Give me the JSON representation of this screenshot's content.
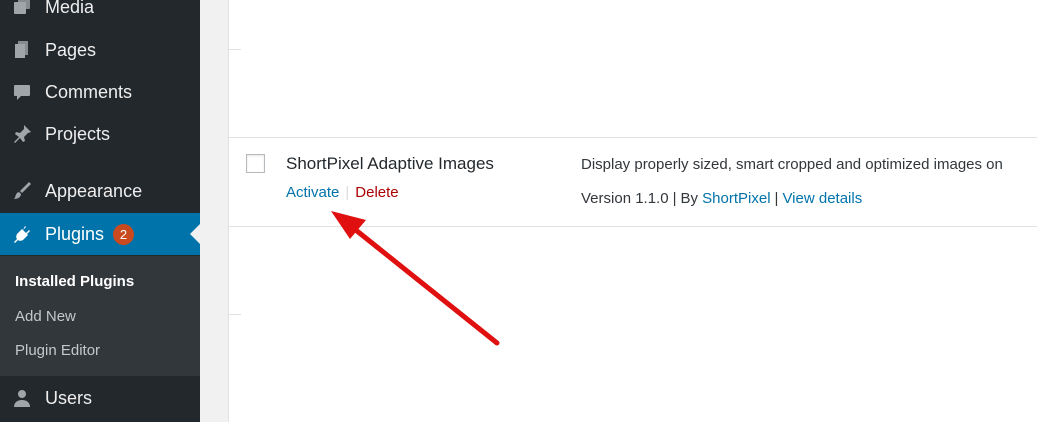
{
  "sidebar": {
    "items": [
      {
        "label": "Media",
        "icon": "media-icon"
      },
      {
        "label": "Pages",
        "icon": "pages-icon"
      },
      {
        "label": "Comments",
        "icon": "comments-icon"
      },
      {
        "label": "Projects",
        "icon": "projects-icon"
      },
      {
        "label": "Appearance",
        "icon": "appearance-icon"
      },
      {
        "label": "Plugins",
        "icon": "plugins-icon",
        "badge": "2",
        "active": true
      },
      {
        "label": "Users",
        "icon": "users-icon"
      }
    ],
    "submenu": [
      {
        "label": "Installed Plugins",
        "current": true
      },
      {
        "label": "Add New"
      },
      {
        "label": "Plugin Editor"
      }
    ]
  },
  "plugin": {
    "name": "ShortPixel Adaptive Images",
    "actions": {
      "activate": "Activate",
      "separator": "|",
      "delete": "Delete"
    },
    "description": "Display properly sized, smart cropped and optimized images on",
    "version_text": "Version 1.1.0",
    "by_text": "By",
    "author": "ShortPixel",
    "view_details": "View details",
    "meta_separator": "|"
  },
  "colors": {
    "sidebar_bg": "#23282d",
    "submenu_bg": "#32373c",
    "active_bg": "#0073aa",
    "badge_bg": "#ca4a1f",
    "link": "#0073aa",
    "delete": "#aa0000",
    "annotation_arrow": "#e01010"
  }
}
